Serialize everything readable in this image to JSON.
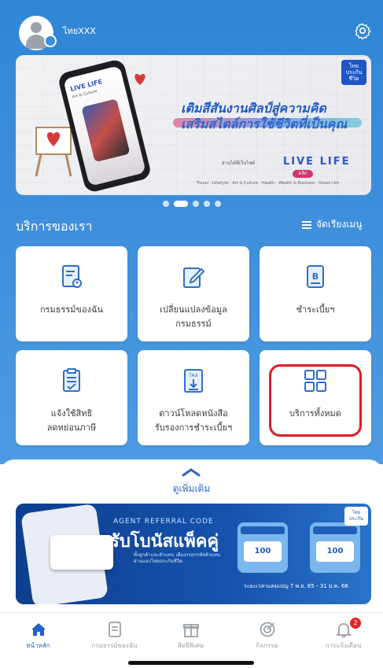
{
  "header": {
    "user_name": "ไทยXXX"
  },
  "banner": {
    "logo_text": "ไทย\nประกัน\nชีวิต",
    "phone_logo": "LIVE LIFE",
    "phone_tag": "Art & Culture",
    "headline_line1": "เติมสีสันงานศิลป์สู่ความคิด",
    "headline_line2": "เสริมสไตล์การใช้ชีวิตที่เป็นคุณ",
    "live_brand": "LIVE LIFE",
    "live_label": "อ่านได้ที่เว็บไซต์",
    "click_label": "คลิก",
    "categories": "Travel · Lifestyle · Art & Culture · Health · Wealth & Business · Green Life",
    "slides": 5,
    "active_slide": 2
  },
  "services": {
    "title": "บริการของเรา",
    "sort_label": "จัดเรียงเมนู",
    "tiles": [
      {
        "label1": "กรมธรรม์ของฉัน",
        "label2": "",
        "icon": "policy-document-icon"
      },
      {
        "label1": "เปลี่ยนแปลงข้อมูล",
        "label2": "กรมธรรม์",
        "icon": "edit-document-icon"
      },
      {
        "label1": "ชำระเบี้ยฯ",
        "label2": "",
        "icon": "baht-payment-icon"
      },
      {
        "label1": "แจ้งใช้สิทธิ",
        "label2": "ลดหย่อนภาษี",
        "icon": "checklist-icon"
      },
      {
        "label1": "ดาวน์โหลดหนังสือ",
        "label2": "รับรองการชำระเบี้ยฯ",
        "icon": "tax-download-icon"
      },
      {
        "label1": "บริการทั้งหมด",
        "label2": "",
        "icon": "grid-icon"
      }
    ]
  },
  "more": {
    "label": "ดูเพิ่มเติม"
  },
  "promo": {
    "subtitle": "AGENT REFERRAL CODE",
    "title": "รับโบนัสแพ็คคู่",
    "desc": "ทั้งลูกค้าและตัวแทน เพียงกรอกรหัสตัวแทนผ่านแอปไทยประกันชีวิต",
    "box1_value": "100",
    "box2_value": "100",
    "date_text": "ระยะเวลาแคมเปญ 7 พ.ย. 65 - 31 ม.ค. 66",
    "logo_text": "ไทย\nประกัน"
  },
  "nav": {
    "items": [
      {
        "label": "หน้าหลัก",
        "active": true
      },
      {
        "label": "กรมธรรม์ของฉัน",
        "active": false
      },
      {
        "label": "สิทธิพิเศษ",
        "active": false
      },
      {
        "label": "กิจกรรม",
        "active": false
      },
      {
        "label": "การแจ้งเตือน",
        "active": false
      }
    ],
    "notification_count": "2"
  },
  "colors": {
    "primary": "#2f86d6",
    "highlight": "#e11b22",
    "nav_active": "#1e63c8",
    "badge": "#e5252a"
  }
}
